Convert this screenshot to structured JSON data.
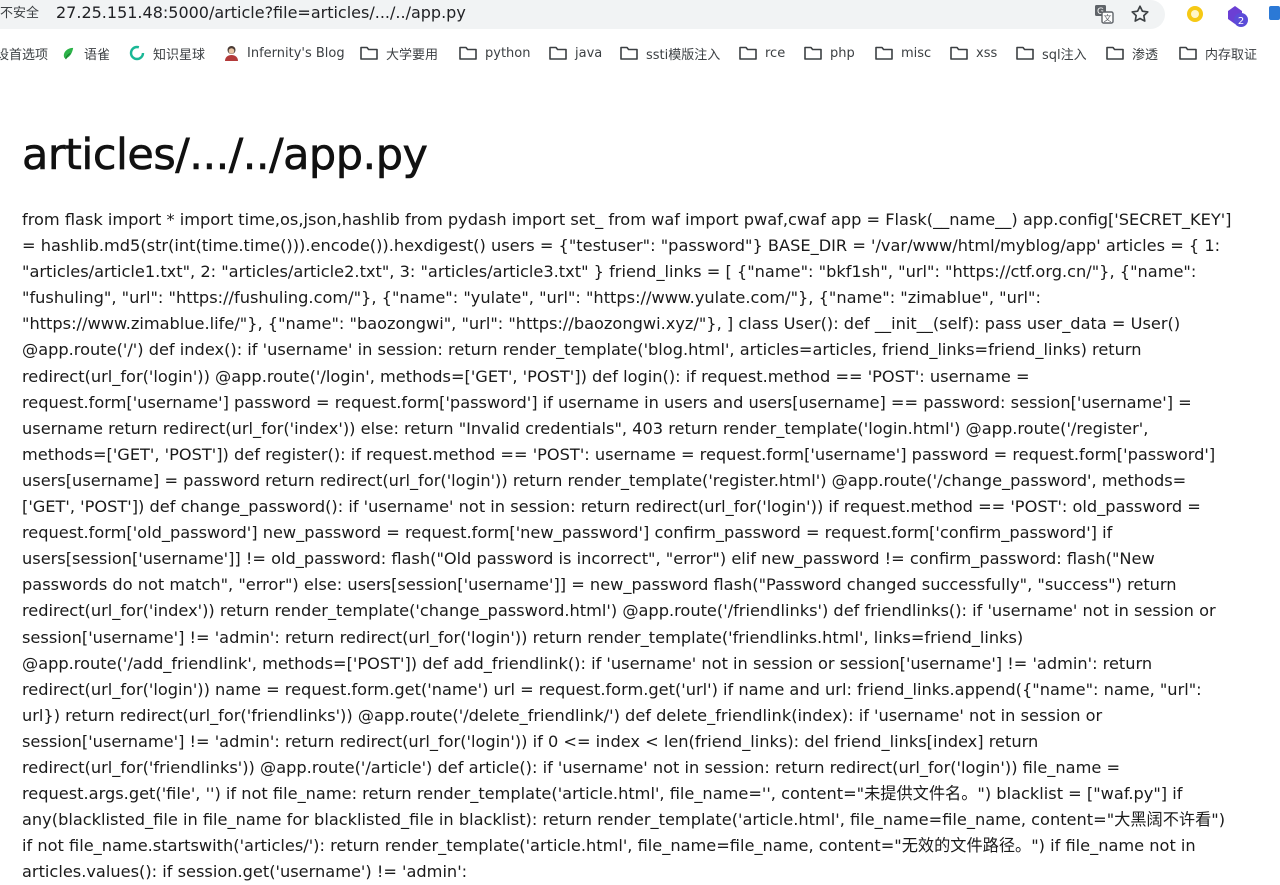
{
  "browser": {
    "security_label": "不安全",
    "url": "27.25.151.48:5000/article?file=articles/.../../app.py",
    "icons": [
      "translate-icon",
      "star-icon",
      "extension-yellow-icon",
      "extension-purple-icon",
      "extension-blue-icon"
    ],
    "extension_badge": "2"
  },
  "bookmarks": [
    {
      "label": "设首选项",
      "icon": "none"
    },
    {
      "label": "语雀",
      "icon": "yuque-icon"
    },
    {
      "label": "知识星球",
      "icon": "zsxq-icon"
    },
    {
      "label": "Infernity's Blog",
      "icon": "avatar-icon"
    },
    {
      "label": "大学要用",
      "icon": "folder-icon"
    },
    {
      "label": "python",
      "icon": "folder-icon"
    },
    {
      "label": "java",
      "icon": "folder-icon"
    },
    {
      "label": "ssti模版注入",
      "icon": "folder-icon"
    },
    {
      "label": "rce",
      "icon": "folder-icon"
    },
    {
      "label": "php",
      "icon": "folder-icon"
    },
    {
      "label": "misc",
      "icon": "folder-icon"
    },
    {
      "label": "xss",
      "icon": "folder-icon"
    },
    {
      "label": "sql注入",
      "icon": "folder-icon"
    },
    {
      "label": "渗透",
      "icon": "folder-icon"
    },
    {
      "label": "内存取证",
      "icon": "folder-icon"
    }
  ],
  "page": {
    "title": "articles/.../../app.py",
    "content": "from flask import * import time,os,json,hashlib from pydash import set_ from waf import pwaf,cwaf app = Flask(__name__) app.config['SECRET_KEY'] = hashlib.md5(str(int(time.time())).encode()).hexdigest() users = {\"testuser\": \"password\"} BASE_DIR = '/var/www/html/myblog/app' articles = { 1: \"articles/article1.txt\", 2: \"articles/article2.txt\", 3: \"articles/article3.txt\" } friend_links = [ {\"name\": \"bkf1sh\", \"url\": \"https://ctf.org.cn/\"}, {\"name\": \"fushuling\", \"url\": \"https://fushuling.com/\"}, {\"name\": \"yulate\", \"url\": \"https://www.yulate.com/\"}, {\"name\": \"zimablue\", \"url\": \"https://www.zimablue.life/\"}, {\"name\": \"baozongwi\", \"url\": \"https://baozongwi.xyz/\"}, ] class User(): def __init__(self): pass user_data = User() @app.route('/') def index(): if 'username' in session: return render_template('blog.html', articles=articles, friend_links=friend_links) return redirect(url_for('login')) @app.route('/login', methods=['GET', 'POST']) def login(): if request.method == 'POST': username = request.form['username'] password = request.form['password'] if username in users and users[username] == password: session['username'] = username return redirect(url_for('index')) else: return \"Invalid credentials\", 403 return render_template('login.html') @app.route('/register', methods=['GET', 'POST']) def register(): if request.method == 'POST': username = request.form['username'] password = request.form['password'] users[username] = password return redirect(url_for('login')) return render_template('register.html') @app.route('/change_password', methods=['GET', 'POST']) def change_password(): if 'username' not in session: return redirect(url_for('login')) if request.method == 'POST': old_password = request.form['old_password'] new_password = request.form['new_password'] confirm_password = request.form['confirm_password'] if users[session['username']] != old_password: flash(\"Old password is incorrect\", \"error\") elif new_password != confirm_password: flash(\"New passwords do not match\", \"error\") else: users[session['username']] = new_password flash(\"Password changed successfully\", \"success\") return redirect(url_for('index')) return render_template('change_password.html') @app.route('/friendlinks') def friendlinks(): if 'username' not in session or session['username'] != 'admin': return redirect(url_for('login')) return render_template('friendlinks.html', links=friend_links) @app.route('/add_friendlink', methods=['POST']) def add_friendlink(): if 'username' not in session or session['username'] != 'admin': return redirect(url_for('login')) name = request.form.get('name') url = request.form.get('url') if name and url: friend_links.append({\"name\": name, \"url\": url}) return redirect(url_for('friendlinks')) @app.route('/delete_friendlink/') def delete_friendlink(index): if 'username' not in session or session['username'] != 'admin': return redirect(url_for('login')) if 0 <= index < len(friend_links): del friend_links[index] return redirect(url_for('friendlinks')) @app.route('/article') def article(): if 'username' not in session: return redirect(url_for('login')) file_name = request.args.get('file', '') if not file_name: return render_template('article.html', file_name='', content=\"未提供文件名。\") blacklist = [\"waf.py\"] if any(blacklisted_file in file_name for blacklisted_file in blacklist): return render_template('article.html', file_name=file_name, content=\"大黑阔不许看\") if not file_name.startswith('articles/'): return render_template('article.html', file_name=file_name, content=\"无效的文件路径。\") if file_name not in articles.values(): if session.get('username') != 'admin':"
  }
}
